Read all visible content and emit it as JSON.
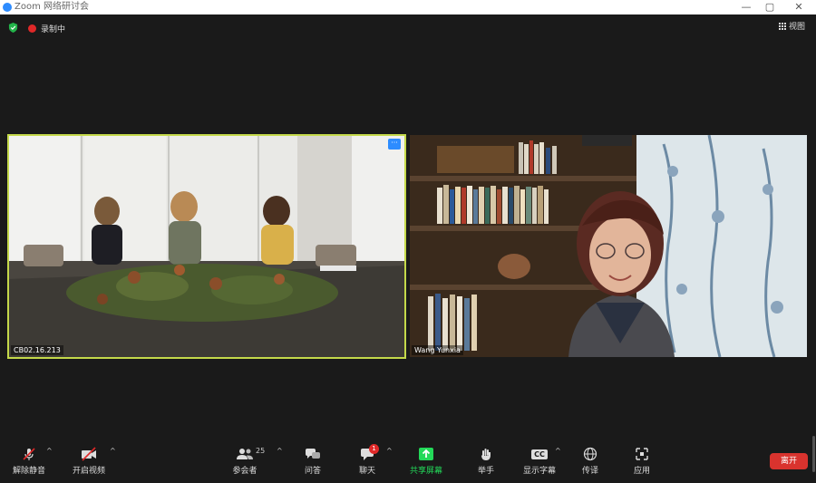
{
  "app": {
    "title": "Zoom 网络研讨会"
  },
  "window_controls": {
    "minimize": "—",
    "maximize": "▢",
    "close": "✕"
  },
  "status": {
    "recording_label": "录制中",
    "view_label": "视图"
  },
  "tiles": [
    {
      "name": "CB02.16.213",
      "more_label": "···"
    },
    {
      "name": "Wang Yunxia"
    }
  ],
  "toolbar": {
    "mute": "解除静音",
    "video": "开启视频",
    "participants": "参会者",
    "participants_count": "25",
    "qa": "问答",
    "chat": "聊天",
    "chat_badge": "1",
    "share": "共享屏幕",
    "raise": "举手",
    "captions": "显示字幕",
    "captions_icon": "CC",
    "interpret": "传译",
    "apps": "应用",
    "leave": "离开"
  },
  "colors": {
    "accent": "#2d8cff",
    "active_speaker_border": "#c4d94a",
    "leave": "#d9332e",
    "share_green": "#23d959",
    "recording_red": "#e02828"
  }
}
